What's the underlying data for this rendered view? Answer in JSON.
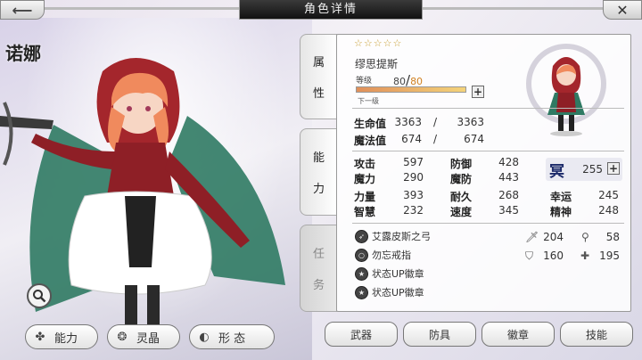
{
  "header": {
    "title": "角色详情",
    "back_icon": "arrow-left-icon",
    "close_icon": "close-icon"
  },
  "character": {
    "name": "诺娜",
    "stars": "☆☆☆☆☆",
    "job": "缪思提斯",
    "level_label": "等级",
    "level": "80",
    "level_max": "80",
    "xp_progress": 1.0,
    "next_label": "下一级"
  },
  "tabs": {
    "attr": [
      "属",
      "性"
    ],
    "ability": [
      "能",
      "力"
    ],
    "task": [
      "任",
      "务"
    ]
  },
  "vitals": [
    {
      "label": "生命值",
      "value": "3363",
      "max": "3363"
    },
    {
      "label": "魔法值",
      "value": "674",
      "max": "674"
    }
  ],
  "stats_left": [
    {
      "label": "攻击",
      "value": "597"
    },
    {
      "label": "魔力",
      "value": "290"
    },
    {
      "label": "力量",
      "value": "393"
    },
    {
      "label": "智慧",
      "value": "232"
    }
  ],
  "stats_mid": [
    {
      "label": "防御",
      "value": "428"
    },
    {
      "label": "魔防",
      "value": "443"
    },
    {
      "label": "耐久",
      "value": "268"
    },
    {
      "label": "速度",
      "value": "345"
    }
  ],
  "stats_right": [
    {
      "label": "幸运",
      "value": "245"
    },
    {
      "label": "精神",
      "value": "248"
    }
  ],
  "rune": {
    "glyph": "冥",
    "value": "255"
  },
  "equipment": [
    {
      "name": "艾露皮斯之弓",
      "icon": "bow-icon"
    },
    {
      "name": "勿忘戒指",
      "icon": "ring-icon"
    },
    {
      "name": "状态UP徽章",
      "icon": "badge-icon"
    },
    {
      "name": "状态UP徽章",
      "icon": "badge-icon"
    }
  ],
  "equip_stats": [
    {
      "icon": "sword-icon",
      "value": "204"
    },
    {
      "icon": "wand-icon",
      "value": "58"
    },
    {
      "icon": "shield-icon",
      "value": "160"
    },
    {
      "icon": "cross-shield-icon",
      "value": "195"
    }
  ],
  "left_buttons": [
    {
      "label": "能力",
      "icon": "clover-icon"
    },
    {
      "label": "灵晶",
      "icon": "crystal-icon"
    },
    {
      "label": "形 态",
      "icon": "mask-icon"
    }
  ],
  "right_buttons": [
    "武器",
    "防具",
    "徽章",
    "技能"
  ],
  "colors": {
    "accent": "#c8a035",
    "xp_start": "#e0905a",
    "xp_end": "#f4d37a",
    "title_bg": "#1a1a1a"
  }
}
